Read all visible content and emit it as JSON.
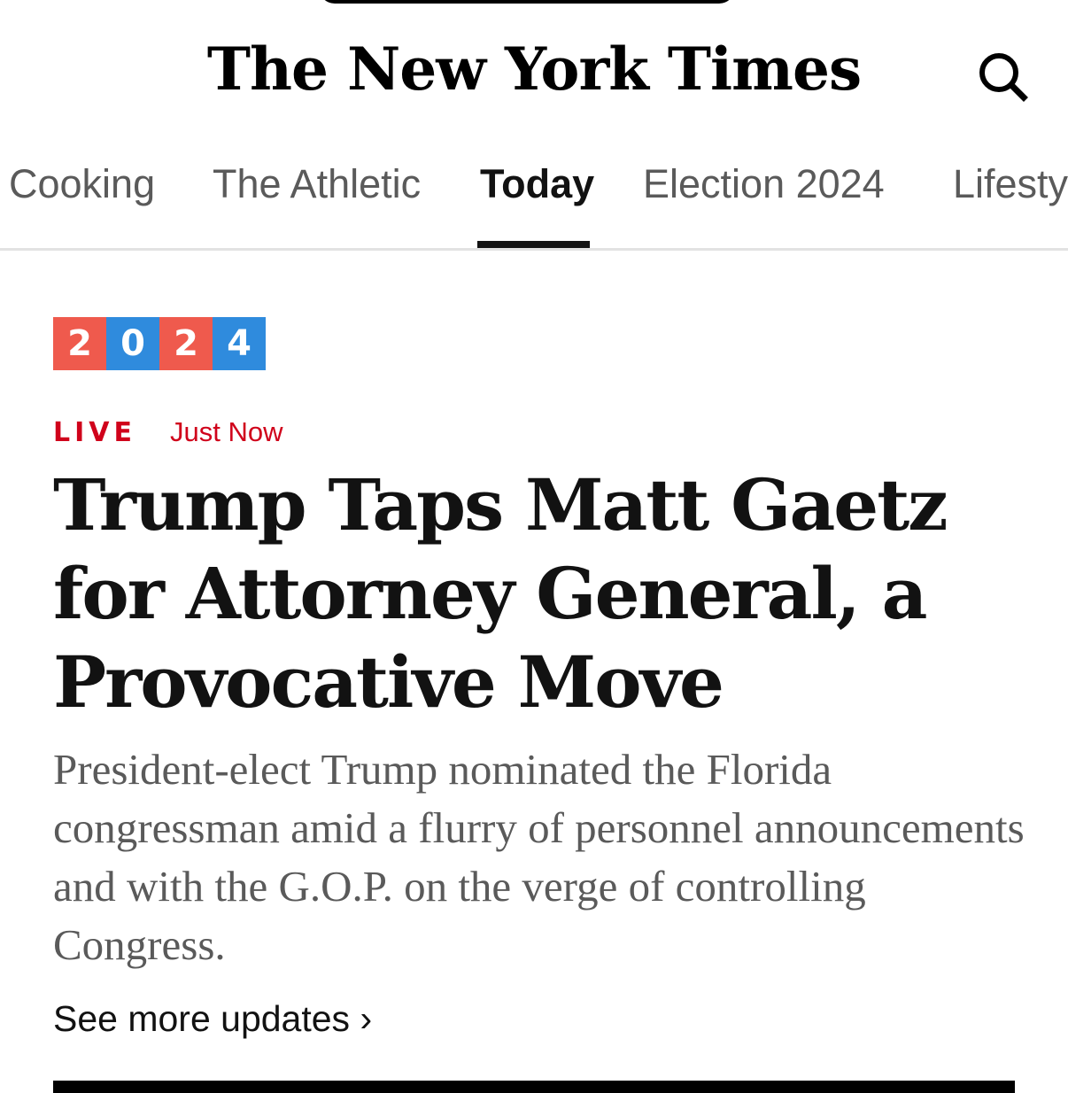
{
  "masthead": {
    "logo_text": "The New York Times",
    "search_icon": "search-icon"
  },
  "nav": {
    "tabs": [
      {
        "label": "Cooking",
        "active": false
      },
      {
        "label": "The Athletic",
        "active": false
      },
      {
        "label": "Today",
        "active": true
      },
      {
        "label": "Election 2024",
        "active": false
      },
      {
        "label": "Lifesty",
        "active": false
      }
    ]
  },
  "story": {
    "badge": {
      "digits": [
        "2",
        "0",
        "2",
        "4"
      ],
      "colors": [
        "#ef5a4d",
        "#2f8bdd",
        "#ef5a4d",
        "#2f8bdd"
      ]
    },
    "live_label": "LIVE",
    "timestamp": "Just Now",
    "headline": "Trump Taps Matt Gaetz for Attorney General, a Provocative Move",
    "summary": "President-elect Trump nominated the Florida congressman amid a flurry of personnel announcements and with the G.O.P. on the verge of controlling Congress.",
    "more_link": "See more updates ›"
  },
  "colors": {
    "accent_red": "#d0021b",
    "text_primary": "#121212",
    "text_secondary": "#5a5a5a"
  }
}
